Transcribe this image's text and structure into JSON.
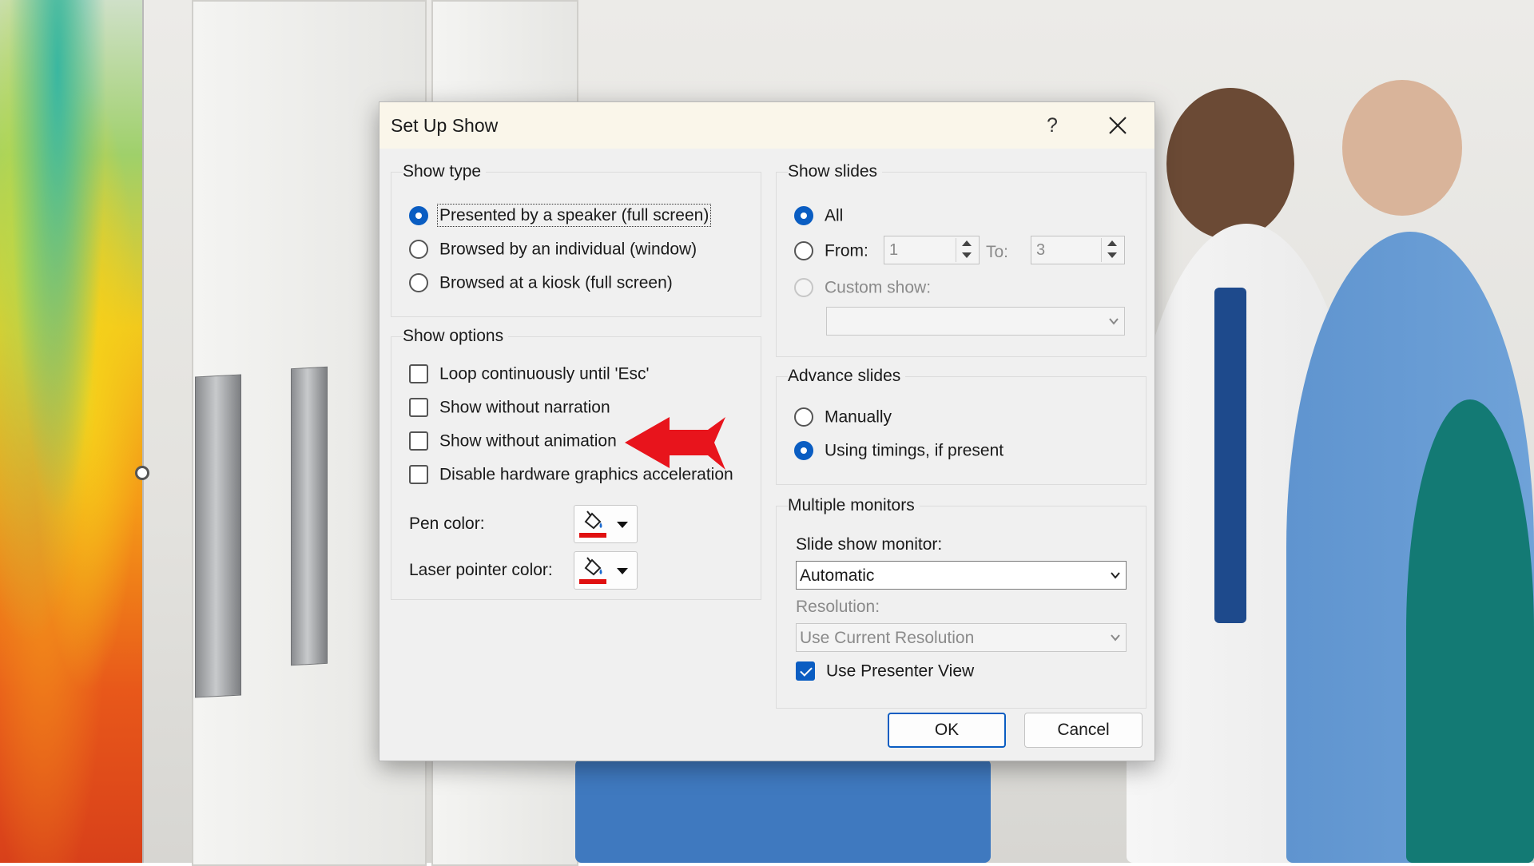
{
  "dialog": {
    "title": "Set Up Show",
    "help": "?",
    "show_type": {
      "legend": "Show type",
      "options": [
        {
          "label": "Presented by a speaker (full screen)",
          "selected": true
        },
        {
          "label": "Browsed by an individual (window)",
          "selected": false
        },
        {
          "label": "Browsed at a kiosk (full screen)",
          "selected": false
        }
      ]
    },
    "show_options": {
      "legend": "Show options",
      "checks": [
        {
          "label": "Loop continuously until 'Esc'",
          "checked": false
        },
        {
          "label": "Show without narration",
          "checked": false
        },
        {
          "label": "Show without animation",
          "checked": false
        },
        {
          "label": "Disable hardware graphics acceleration",
          "checked": false
        }
      ],
      "pen_color_label": "Pen color:",
      "laser_color_label": "Laser pointer color:",
      "pen_color": "#e01010",
      "laser_color": "#e01010"
    },
    "show_slides": {
      "legend": "Show slides",
      "all_label": "All",
      "from_label": "From:",
      "from_value": "1",
      "to_label": "To:",
      "to_value": "3",
      "custom_label": "Custom show:",
      "custom_value": ""
    },
    "advance_slides": {
      "legend": "Advance slides",
      "options": [
        {
          "label": "Manually",
          "selected": false
        },
        {
          "label": "Using timings, if present",
          "selected": true
        }
      ]
    },
    "monitors": {
      "legend": "Multiple monitors",
      "monitor_label": "Slide show monitor:",
      "monitor_value": "Automatic",
      "resolution_label": "Resolution:",
      "resolution_value": "Use Current Resolution",
      "presenter_view_label": "Use Presenter View",
      "presenter_view_checked": true
    },
    "ok_label": "OK",
    "cancel_label": "Cancel"
  },
  "annotation": {
    "icon": "red-arrow-icon",
    "color": "#e8141c"
  },
  "colors": {
    "accent": "#0a5dc2",
    "title_bar": "#faf6ea",
    "dialog_bg": "#f0f0f0"
  }
}
